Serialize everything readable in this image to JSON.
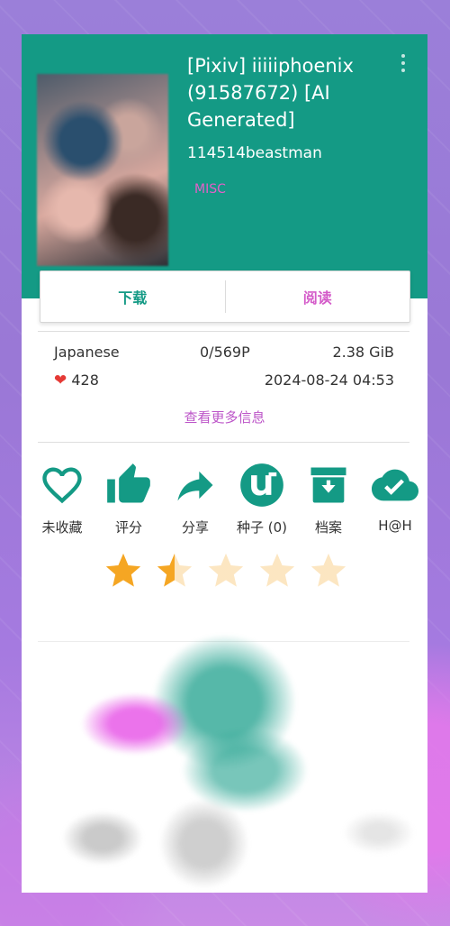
{
  "header": {
    "title": "[Pixiv] iiiiiphoenix (91587672) [AI Generated]",
    "uploader": "114514beastman",
    "category": "MISC",
    "menu_icon": "more-vert-icon"
  },
  "buttons": {
    "download": "下载",
    "read": "阅读"
  },
  "info": {
    "language": "Japanese",
    "pages": "0/569P",
    "size": "2.38 GiB",
    "favorites": "428",
    "posted": "2024-08-24 04:53",
    "more_info": "查看更多信息"
  },
  "actions": [
    {
      "icon": "heart-outline-icon",
      "label": "未收藏"
    },
    {
      "icon": "thumb-up-icon",
      "label": "评分"
    },
    {
      "icon": "share-icon",
      "label": "分享"
    },
    {
      "icon": "utorrent-icon",
      "label": "种子 (0)"
    },
    {
      "icon": "archive-icon",
      "label": "档案"
    },
    {
      "icon": "cloud-check-icon",
      "label": "H@H"
    }
  ],
  "rating": {
    "value": 1.5,
    "max": 5
  },
  "colors": {
    "primary": "#149a85",
    "accent": "#d45bc9",
    "star": "#f5a623",
    "heart": "#e53935"
  }
}
